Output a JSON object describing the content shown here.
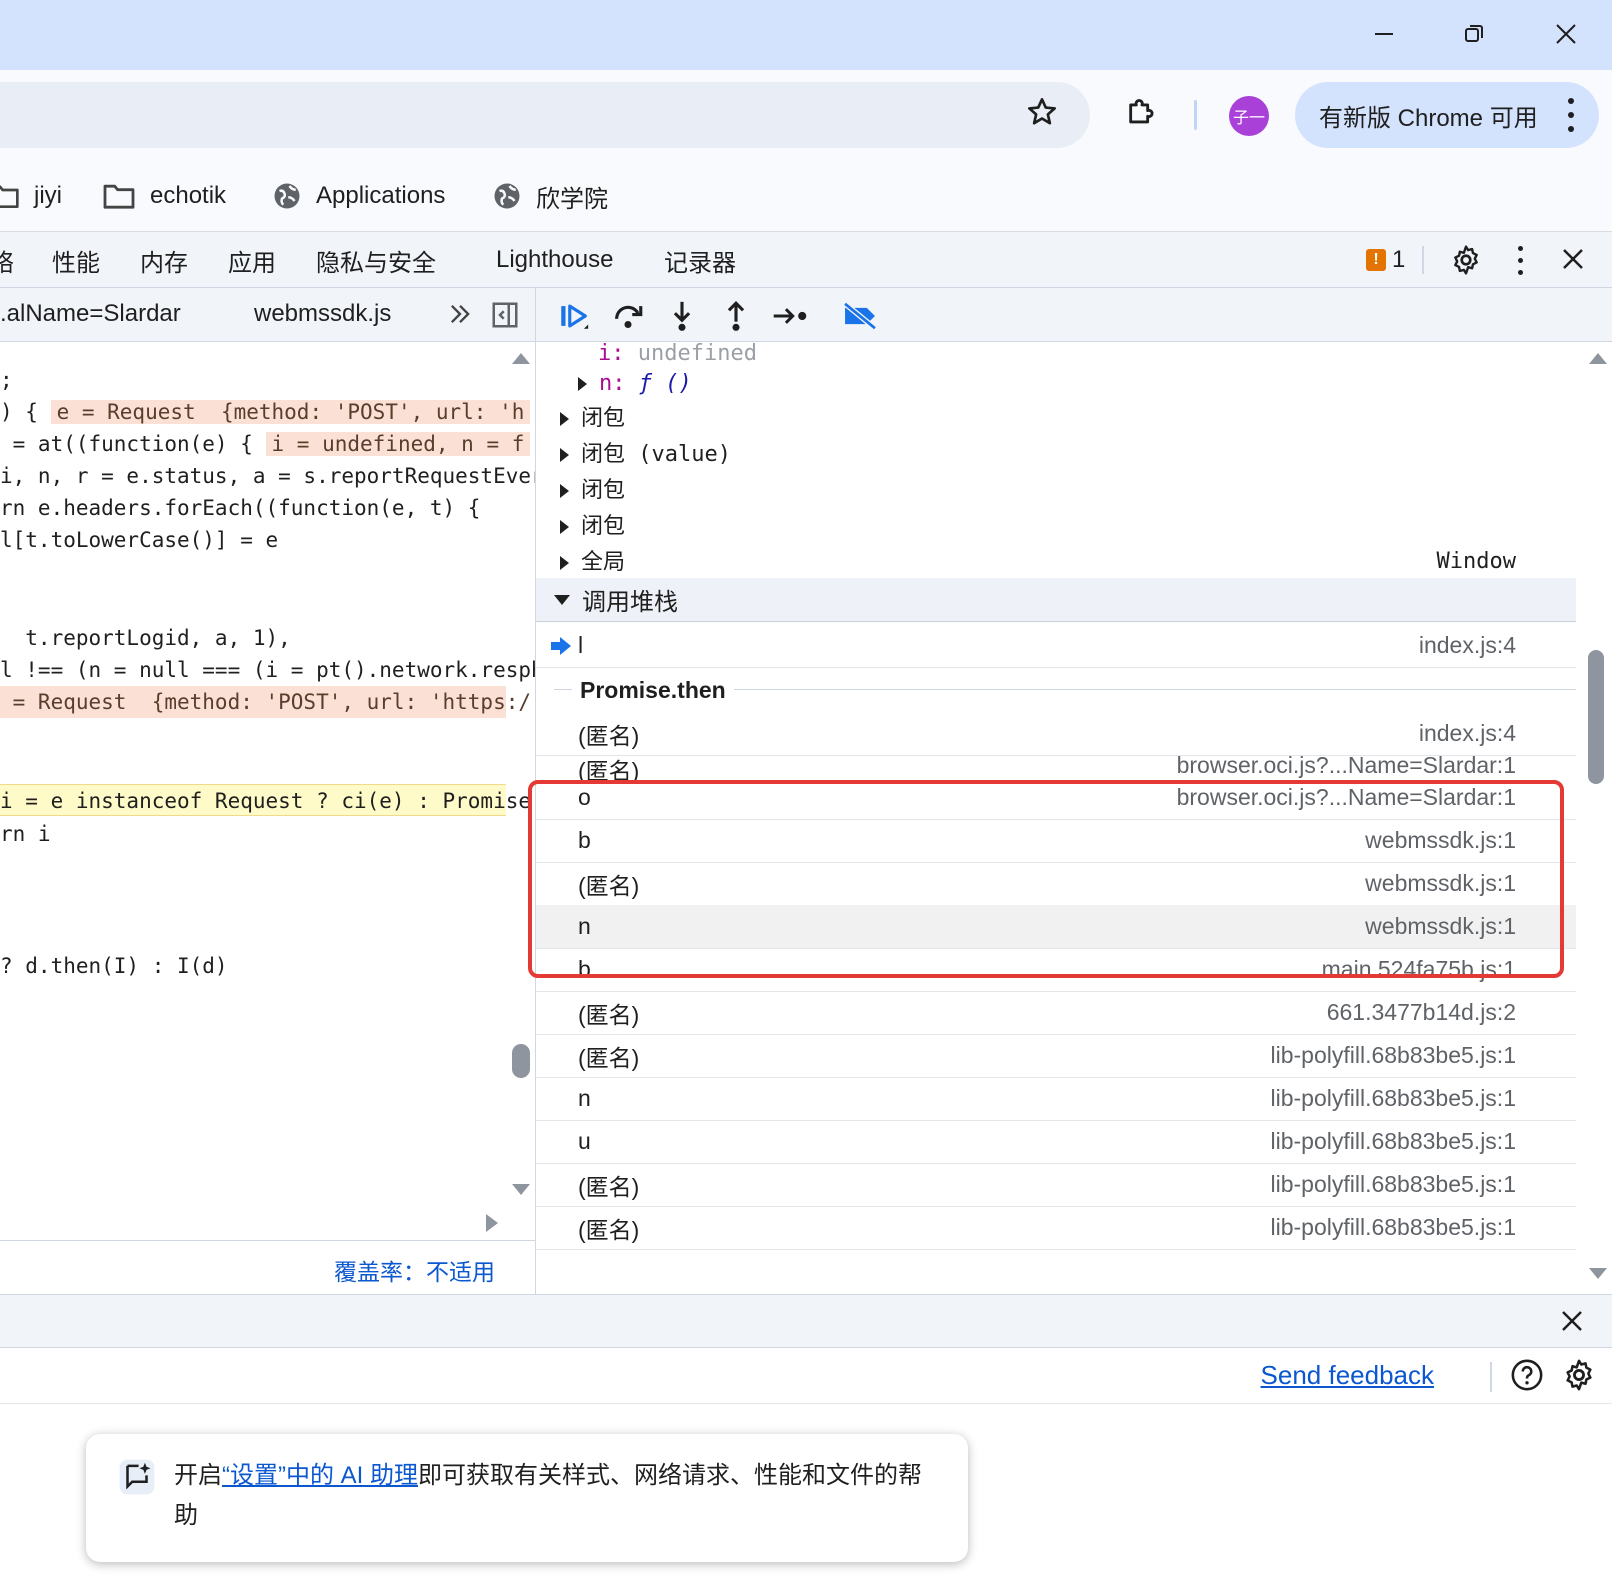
{
  "browser": {
    "update_button": "有新版 Chrome 可用",
    "avatar_text": "子一"
  },
  "bookmarks": [
    {
      "label": "jiyi",
      "icon": "folder-icon"
    },
    {
      "label": "echotik",
      "icon": "folder-icon"
    },
    {
      "label": "Applications",
      "icon": "globe-icon"
    },
    {
      "label": "欣学院",
      "icon": "globe-icon"
    }
  ],
  "devtools": {
    "tabs": [
      "络",
      "性能",
      "内存",
      "应用",
      "隐私与安全",
      "Lighthouse",
      "记录器"
    ],
    "issue_count": "1",
    "source_tabs": [
      ".alName=Slardar",
      "webmssdk.js"
    ],
    "coverage": "覆盖率：不适用"
  },
  "code_lines": [
    {
      "text": ";"
    },
    {
      "text": ") { ",
      "inline": "e = Request  {method: 'POST', url: 'h"
    },
    {
      "text": " = at((function(e) { ",
      "inline": "i = undefined, n = f"
    },
    {
      "text": "i, n, r = e.status, a = s.reportRequestEver"
    },
    {
      "text": "rn e.headers.forEach((function(e, t) {"
    },
    {
      "text": "l[t.toLowerCase()] = e"
    },
    {
      "text": "  t.reportLogid, a, 1),"
    },
    {
      "text": "l !== (n = null === (i = pt().network.resph"
    },
    {
      "text": " = Request  {method: 'POST', url: 'https:/"
    },
    {
      "text": "i = e instanceof Request ? ci(e) : Promise."
    },
    {
      "text": "rn i"
    },
    {
      "text": "? d.then(I) : I(d)"
    }
  ],
  "scope": {
    "var_i_name": "i",
    "var_i_value": "undefined",
    "var_n_name": "n",
    "var_n_value": "ƒ ()",
    "closures": [
      "闭包",
      "闭包 (value)",
      "闭包",
      "闭包"
    ],
    "global_label": "全局",
    "global_value": "Window"
  },
  "callstack": {
    "title": "调用堆栈",
    "async_label": "Promise.then",
    "frames": [
      {
        "fn": "l",
        "loc": "index.js:4",
        "current": true
      },
      {
        "fn": "(匿名)",
        "loc": "index.js:4"
      },
      {
        "fn": "(匿名)",
        "loc": "browser.oci.js?...Name=Slardar:1"
      },
      {
        "fn": "o",
        "loc": "browser.oci.js?...Name=Slardar:1"
      },
      {
        "fn": "b",
        "loc": "webmssdk.js:1"
      },
      {
        "fn": "(匿名)",
        "loc": "webmssdk.js:1"
      },
      {
        "fn": "n",
        "loc": "webmssdk.js:1"
      },
      {
        "fn": "b",
        "loc": "main.524fa75b.js:1"
      },
      {
        "fn": "(匿名)",
        "loc": "661.3477b14d.js:2"
      },
      {
        "fn": "(匿名)",
        "loc": "lib-polyfill.68b83be5.js:1"
      },
      {
        "fn": "n",
        "loc": "lib-polyfill.68b83be5.js:1"
      },
      {
        "fn": "u",
        "loc": "lib-polyfill.68b83be5.js:1"
      },
      {
        "fn": "(匿名)",
        "loc": "lib-polyfill.68b83be5.js:1"
      },
      {
        "fn": "(匿名)",
        "loc": "lib-polyfill.68b83be5.js:1"
      }
    ]
  },
  "drawer": {
    "send_feedback": "Send feedback"
  },
  "ai_toast": {
    "prefix": "开启",
    "link": "“设置”中的 AI 助理",
    "suffix": "即可获取有关样式、网络请求、性能和文件的帮助"
  },
  "colors": {
    "titlebar": "#d3e3fd",
    "highlight_box": "#e53935",
    "link": "#0b57d0"
  }
}
